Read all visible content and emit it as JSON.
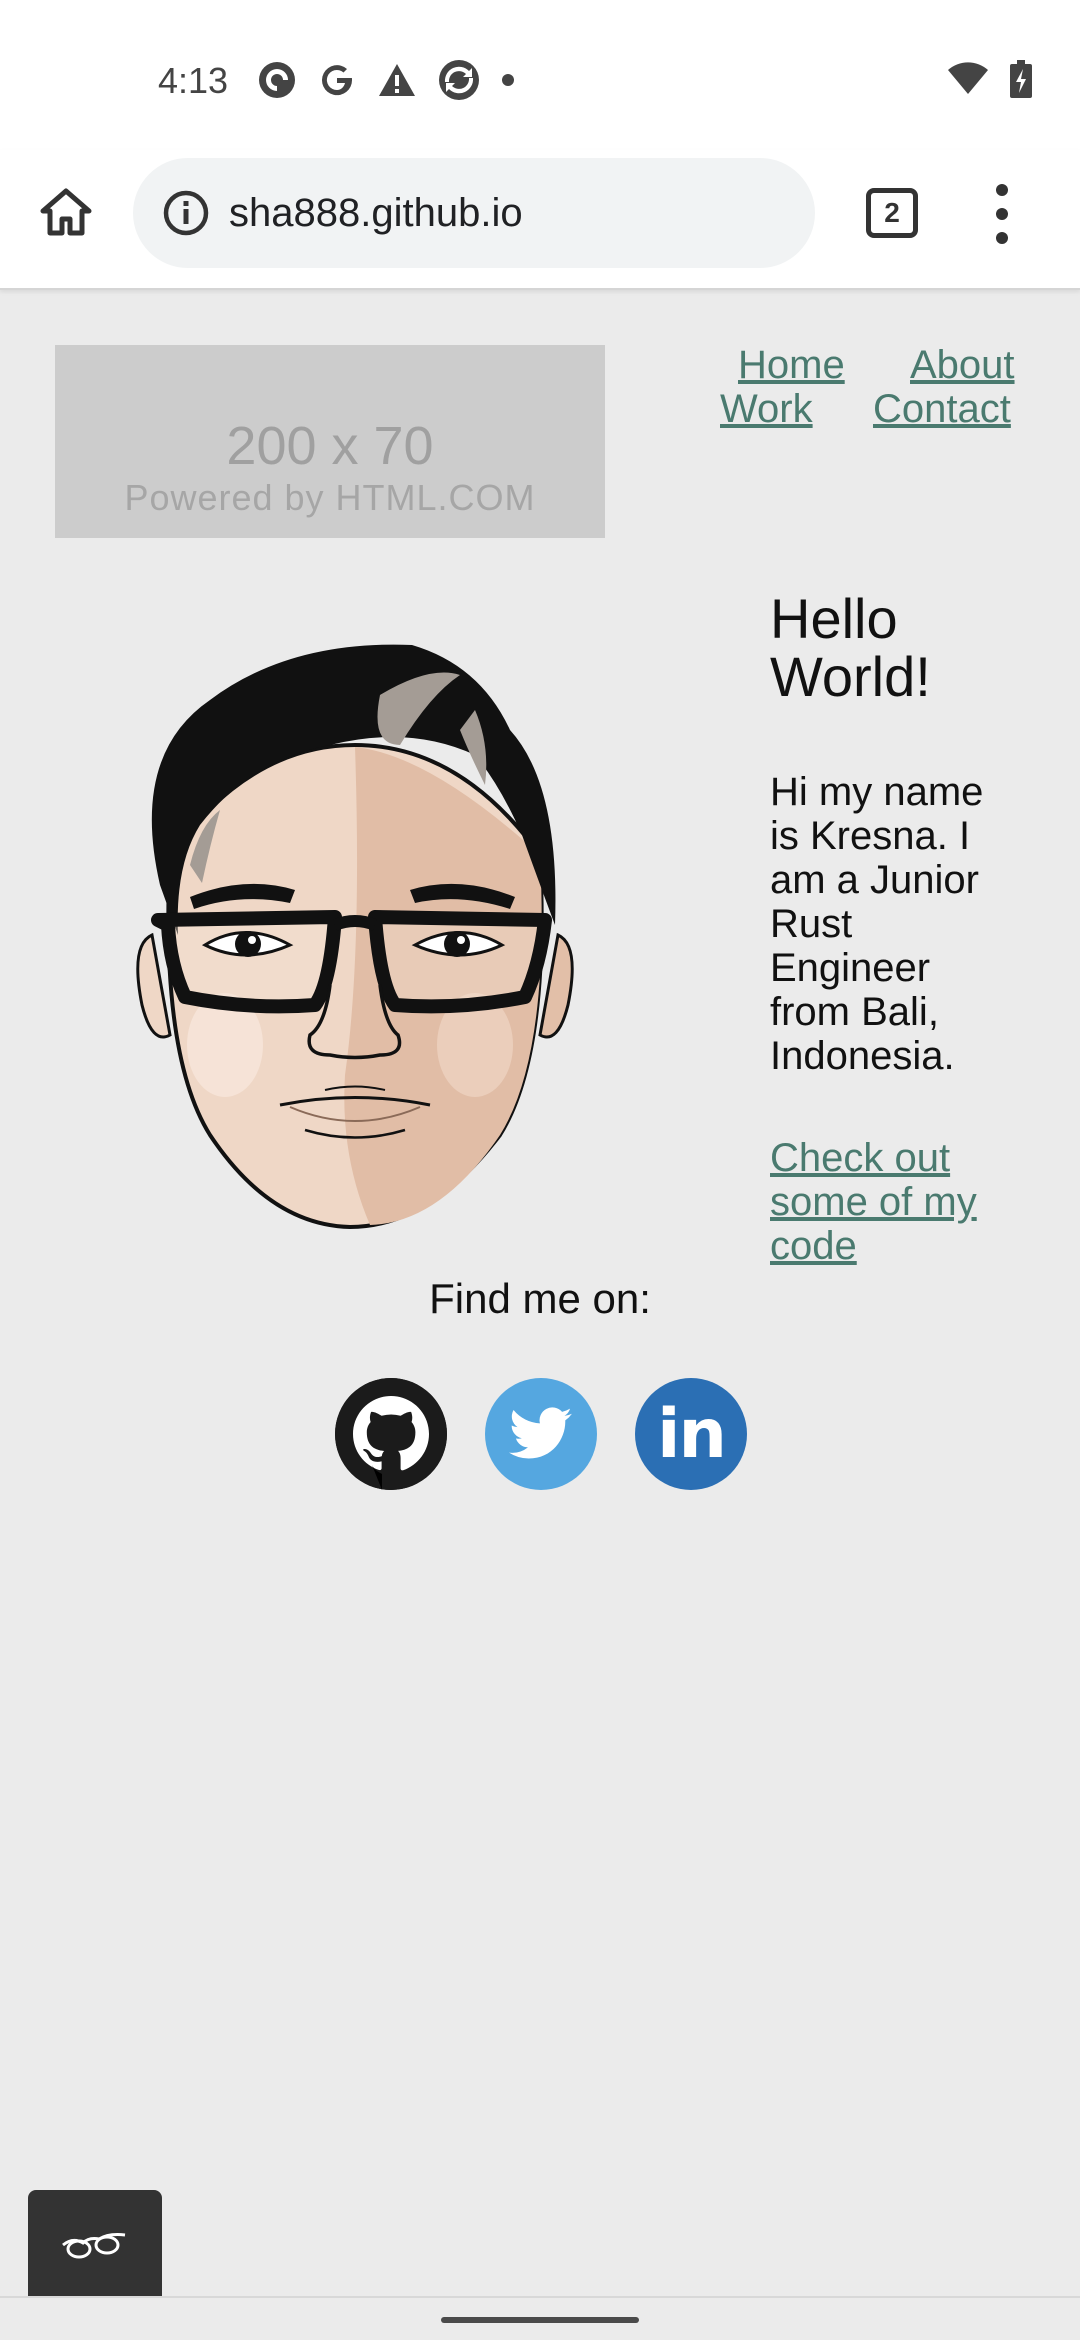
{
  "status_bar": {
    "time": "4:13",
    "notification_icons": [
      "pocket-casts-icon",
      "google-icon",
      "warning-icon",
      "sync-icon",
      "dot-icon"
    ],
    "right_icons": [
      "wifi-icon",
      "battery-charging-icon"
    ]
  },
  "browser": {
    "url": "sha888.github.io",
    "tab_count": "2"
  },
  "page": {
    "logo_placeholder": {
      "size_text": "200 x 70",
      "powered_text": "Powered by HTML.COM"
    },
    "nav": {
      "home": "Home",
      "about": "About",
      "work": "Work",
      "contact": "Contact"
    },
    "heading": "Hello World!",
    "bio": "Hi my name is Kresna. I am a Junior Rust Engineer from Bali, Indonesia.",
    "code_link": "Check out some of my code",
    "find_me": "Find me on:",
    "social": {
      "linkedin_text": "in"
    },
    "colors": {
      "link": "#4a7a6f",
      "background": "#ebebeb",
      "twitter": "#55a7e0",
      "linkedin": "#2b6fb4",
      "github": "#1b1b1b"
    }
  }
}
